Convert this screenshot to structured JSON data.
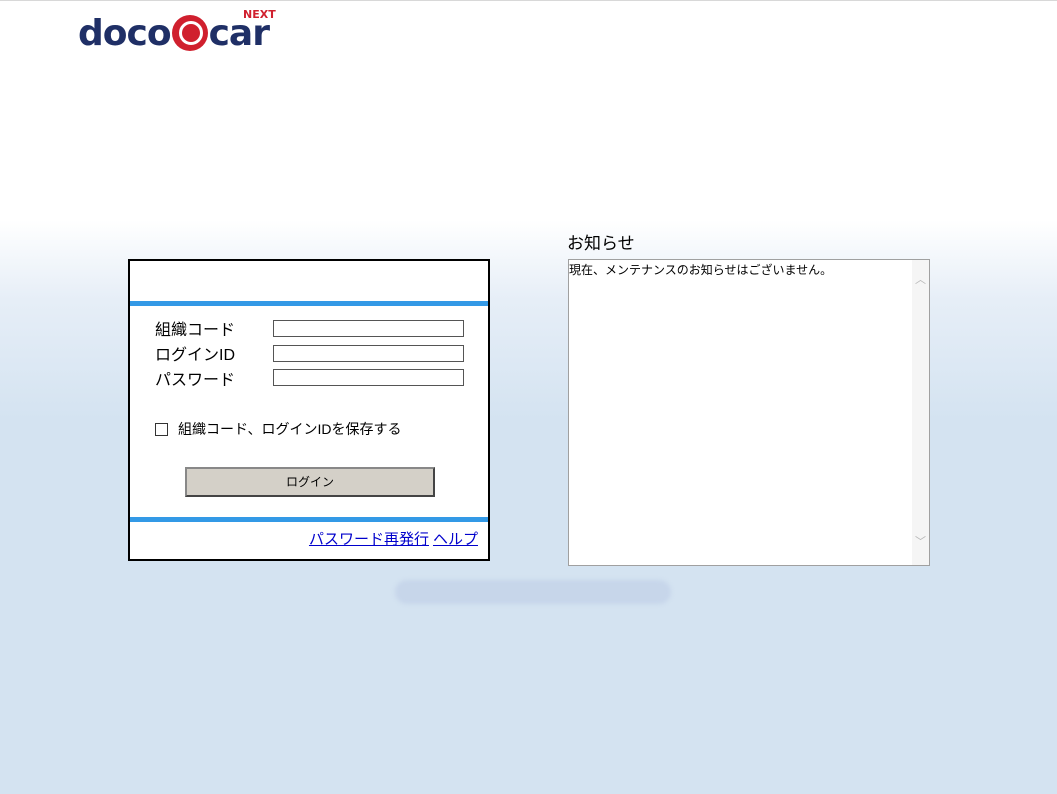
{
  "logo": {
    "text_left": "doco",
    "text_right": "car",
    "badge": "NEXT"
  },
  "login": {
    "org_code_label": "組織コード",
    "login_id_label": "ログインID",
    "password_label": "パスワード",
    "org_code_value": "",
    "login_id_value": "",
    "password_value": "",
    "save_label": "組織コード、ログインIDを保存する",
    "login_button": "ログイン",
    "password_reissue_link": "パスワード再発行",
    "help_link": "ヘルプ"
  },
  "notice": {
    "title": "お知らせ",
    "content": "現在、メンテナンスのお知らせはございません。"
  },
  "colors": {
    "accent_bar": "#3399e6",
    "logo_red": "#d0202e",
    "logo_navy": "#1f2f66"
  }
}
